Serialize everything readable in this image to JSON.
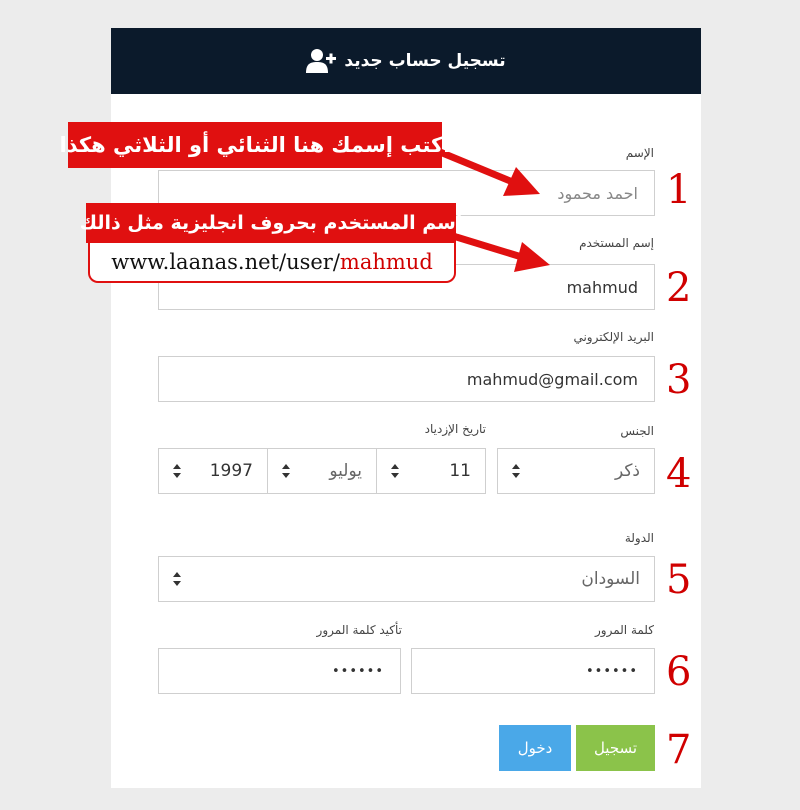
{
  "header": {
    "title": "تسجيل حساب جديد",
    "icon": "user-plus-icon"
  },
  "form": {
    "name": {
      "label": "الإسم",
      "placeholder": "احمد محمود"
    },
    "username": {
      "label": "إسم المستخدم",
      "value": "mahmud"
    },
    "email": {
      "label": "البريد الإلكتروني",
      "value": "mahmud@gmail.com"
    },
    "gender": {
      "label": "الجنس",
      "value": "ذكر"
    },
    "birthdate": {
      "label": "تاريخ الإزدياد",
      "day": "11",
      "month": "يوليو",
      "year": "1997"
    },
    "country": {
      "label": "الدولة",
      "value": "السودان"
    },
    "password": {
      "label": "كلمة المرور",
      "value": "••••••"
    },
    "confirm_password": {
      "label": "تأكيد كلمة المرور",
      "value": "••••••"
    }
  },
  "buttons": {
    "register": "تسجيل",
    "login": "دخول"
  },
  "annotations": {
    "name_hint": "اكتب إسمك هنا الثنائي أو الثلاثي هكذا",
    "username_hint": "إسم المستخدم بحروف انجليزية مثل ذالك",
    "url_prefix": "www.laanas.net/user/",
    "url_user": "mahmud",
    "steps": [
      "1",
      "2",
      "3",
      "4",
      "5",
      "6",
      "7"
    ]
  },
  "colors": {
    "header_bg": "#0b1a2b",
    "register_button": "#8bc34a",
    "login_button": "#4aa8e8",
    "annotation_red": "#e01010"
  }
}
